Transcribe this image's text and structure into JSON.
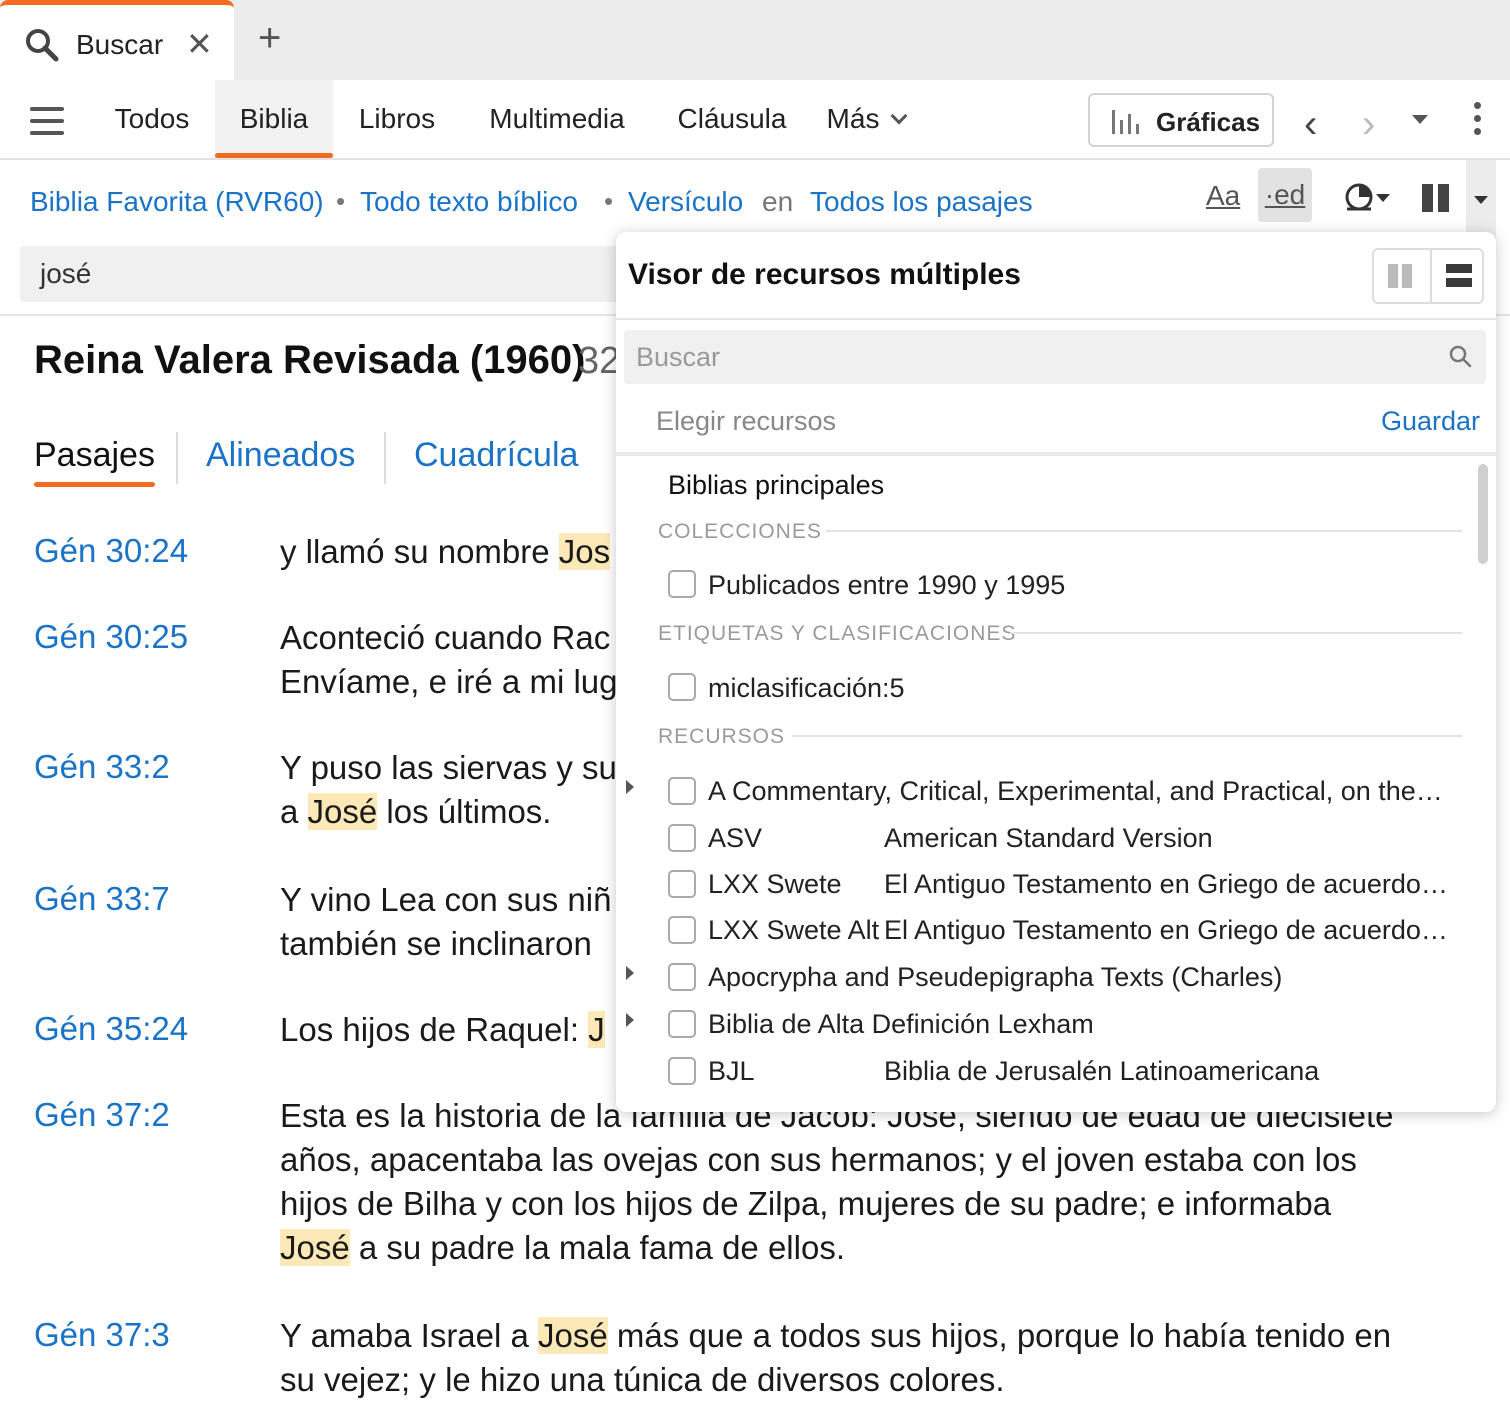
{
  "tab": {
    "title": "Buscar",
    "icon": "search-icon",
    "close_icon": "close-icon",
    "new_tab_icon": "plus-icon"
  },
  "nav": {
    "items": [
      "Todos",
      "Biblia",
      "Libros",
      "Multimedia",
      "Cláusula",
      "Más"
    ],
    "active": "Biblia",
    "graficas_label": "Gráficas"
  },
  "filters": {
    "bible": "Biblia Favorita (RVR60)",
    "scope": "Todo texto bíblico",
    "match": "Versículo",
    "in_word": "en",
    "range": "Todos los pasajes",
    "aa": "Aa",
    "ed": "·ed"
  },
  "query": "josé",
  "results": {
    "title": "Reina Valera Revisada (1960)",
    "count": "32",
    "view_tabs": [
      "Pasajes",
      "Alineados",
      "Cuadrícula"
    ],
    "active_view": "Pasajes",
    "verses": [
      {
        "ref": "Gén 30:24",
        "parts": [
          "y llamó su nombre ",
          "Jos"
        ],
        "hl": [
          1
        ]
      },
      {
        "ref": "Gén 30:25",
        "lines": [
          "Aconteció cuando Rac",
          "Envíame, e iré a mi lug"
        ]
      },
      {
        "ref": "Gén 33:2",
        "line1": "Y puso las siervas y su",
        "line2_parts": [
          "a ",
          "José",
          " los últimos."
        ]
      },
      {
        "ref": "Gén 33:7",
        "lines": [
          "Y vino Lea con sus niñ",
          "también se inclinaron"
        ]
      },
      {
        "ref": "Gén 35:24",
        "parts": [
          "Los hijos de Raquel: ",
          "J"
        ]
      },
      {
        "ref": "Gén 37:2",
        "lines": [
          "Esta es la historia de la familia de Jacob: José, siendo de edad de diecisiete",
          "años, apacentaba las ovejas con sus hermanos; y el joven estaba con los",
          "hijos de Bilha y con los hijos de Zilpa, mujeres de su padre; e informaba"
        ],
        "last_parts": [
          "José",
          " a su padre la mala fama de ellos."
        ]
      },
      {
        "ref": "Gén 37:3",
        "parts": [
          "Y amaba Israel a ",
          "José",
          " más que a todos sus hijos, porque lo había tenido en"
        ],
        "line2": "su vejez; y le hizo una túnica de diversos colores."
      }
    ]
  },
  "popover": {
    "title": "Visor de recursos múltiples",
    "search_placeholder": "Buscar",
    "choose_label": "Elegir recursos",
    "save_label": "Guardar",
    "top_item": "Biblias principales",
    "sections": {
      "collections": "COLECCIONES",
      "tags": "ETIQUETAS Y CLASIFICACIONES",
      "resources": "RECURSOS"
    },
    "collection_item": "Publicados entre 1990 y 1995",
    "tag_item": "miclasificación:5",
    "resources": [
      {
        "abbr": "A Commentary, Critical, Experimental, and Practical, on the…",
        "desc": "",
        "expand": true
      },
      {
        "abbr": "ASV",
        "desc": "American Standard Version",
        "expand": false
      },
      {
        "abbr": "LXX Swete",
        "desc": "El Antiguo Testamento en Griego de acuerdo…",
        "expand": false
      },
      {
        "abbr": "LXX Swete Alt",
        "desc": "El Antiguo Testamento en Griego de acuerdo…",
        "expand": false
      },
      {
        "abbr": "Apocrypha and Pseudepigrapha Texts (Charles)",
        "desc": "",
        "expand": true
      },
      {
        "abbr": "Biblia de Alta Definición Lexham",
        "desc": "",
        "expand": true
      },
      {
        "abbr": "BJL",
        "desc": "Biblia de Jerusalén Latinoamericana",
        "expand": false
      }
    ]
  },
  "colors": {
    "accent": "#f26b21",
    "link": "#1a73c7",
    "highlight": "#fde9b8"
  }
}
